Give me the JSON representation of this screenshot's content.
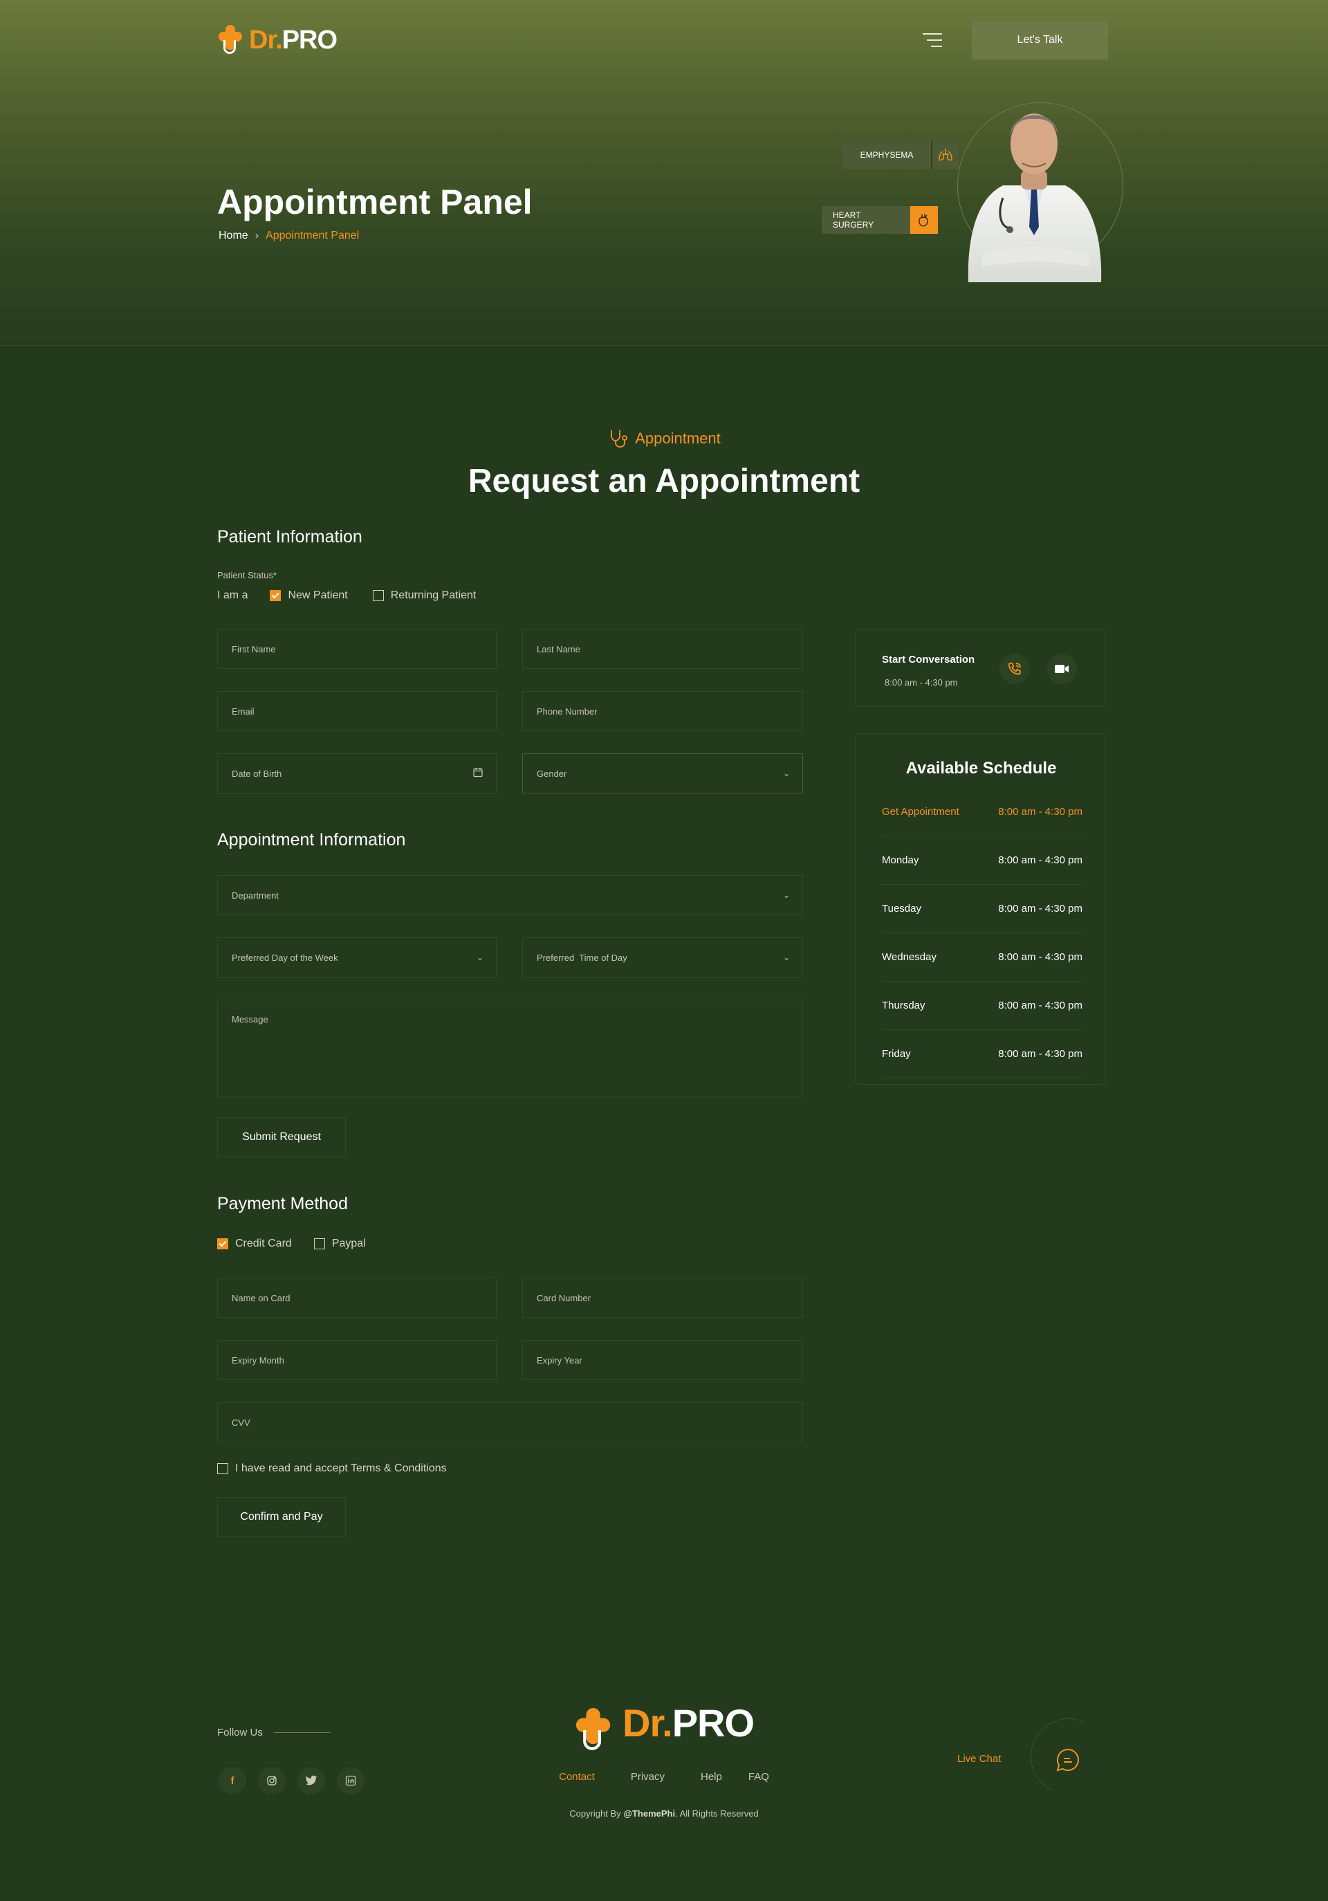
{
  "header": {
    "logo_dr": "Dr.",
    "logo_pro": "PRO",
    "cta_label": "Let's Talk"
  },
  "hero": {
    "title": "Appointment Panel",
    "breadcrumb": {
      "home": "Home",
      "separator": "›",
      "current": "Appointment Panel"
    },
    "tags": {
      "emphysema": "EMPHYSEMA",
      "heart_surgery": "HEART SURGERY"
    }
  },
  "section": {
    "subtitle": "Appointment",
    "title": "Request an Appointment"
  },
  "patient": {
    "heading": "Patient Information",
    "status_label": "Patient Status*",
    "i_am": "I am a",
    "options": [
      {
        "label": "New Patient",
        "checked": true
      },
      {
        "label": "Returning Patient",
        "checked": false
      }
    ],
    "fields": {
      "first_name": "First Name",
      "last_name": "Last Name",
      "email": "Email",
      "phone": "Phone Number",
      "dob": "Date of Birth",
      "gender": "Gender"
    }
  },
  "appointment": {
    "heading": "Appointment Information",
    "fields": {
      "department": "Department",
      "preferred_day": "Preferred Day of the Week",
      "preferred_time": "Preferred  Time of Day",
      "message": "Message"
    },
    "submit_label": "Submit Request"
  },
  "payment": {
    "heading": "Payment Method",
    "options": [
      {
        "label": "Credit Card",
        "checked": true
      },
      {
        "label": "Paypal",
        "checked": false
      }
    ],
    "fields": {
      "name_on_card": "Name on Card",
      "card_number": "Card Number",
      "expiry_month": "Expiry Month",
      "expiry_year": "Expiry Year",
      "cvv": "CVV"
    },
    "terms_label": "I have read and accept Terms & Conditions",
    "confirm_label": "Confirm and Pay"
  },
  "sidebar": {
    "conversation": {
      "title": "Start Conversation",
      "hours": "8:00 am - 4:30 pm"
    },
    "schedule": {
      "title": "Available Schedule",
      "rows": [
        {
          "day": "Get Appointment",
          "hours": "8:00 am - 4:30 pm",
          "highlight": true
        },
        {
          "day": "Monday",
          "hours": "8:00 am - 4:30 pm"
        },
        {
          "day": "Tuesday",
          "hours": "8:00 am - 4:30 pm"
        },
        {
          "day": "Wednesday",
          "hours": "8:00 am - 4:30 pm"
        },
        {
          "day": "Thursday",
          "hours": "8:00 am - 4:30 pm"
        },
        {
          "day": "Friday",
          "hours": "8:00 am - 4:30 pm"
        }
      ]
    }
  },
  "footer": {
    "follow_us": "Follow Us",
    "social": [
      "facebook-icon",
      "instagram-icon",
      "twitter-icon",
      "linkedin-icon"
    ],
    "links": [
      "Contact",
      "Privacy",
      "Help",
      "FAQ"
    ],
    "copyright_prefix": "Copyright By ",
    "copyright_brand": "@ThemePhi",
    "copyright_suffix": ". All Rights Reserved",
    "live_chat": "Live Chat"
  },
  "colors": {
    "accent": "#f3931e",
    "background": "#243a1d"
  }
}
